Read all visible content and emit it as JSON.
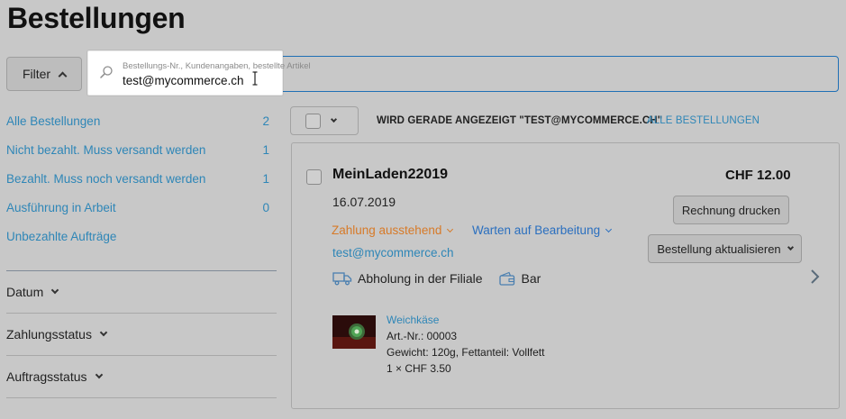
{
  "page": {
    "title": "Bestellungen"
  },
  "toolbar": {
    "filter_label": "Filter",
    "search_placeholder": "Bestellungs-Nr., Kundenangaben, bestellte Artikel",
    "search_value": "test@mycommerce.ch"
  },
  "sidebar": {
    "items": [
      {
        "label": "Alle Bestellungen",
        "count": "2"
      },
      {
        "label": "Nicht bezahlt. Muss versandt werden",
        "count": "1"
      },
      {
        "label": "Bezahlt. Muss noch versandt werden",
        "count": "1"
      },
      {
        "label": "Ausführung in Arbeit",
        "count": "0"
      },
      {
        "label": "Unbezahlte Aufträge",
        "count": ""
      }
    ],
    "sections": [
      {
        "label": "Datum"
      },
      {
        "label": "Zahlungsstatus"
      },
      {
        "label": "Auftragsstatus"
      }
    ]
  },
  "listing": {
    "showing_label": "WIRD GERADE ANGEZEIGT \"TEST@MYCOMMERCE.CH\"",
    "all_orders_link": "ALLE BESTELLUNGEN"
  },
  "order": {
    "name": "MeinLaden22019",
    "total": "CHF 12.00",
    "date": "16.07.2019",
    "print_button": "Rechnung drucken",
    "update_button": "Bestellung aktualisieren",
    "payment_status": "Zahlung ausstehend",
    "fulfillment_status": "Warten auf Bearbeitung",
    "email": "test@mycommerce.ch",
    "shipping": "Abholung in der Filiale",
    "payment_method": "Bar",
    "product": {
      "name": "Weichkäse",
      "sku": "Art.-Nr.: 00003",
      "details": "Gewicht: 120g, Fettanteil: Vollfett",
      "qty_price": "1 × CHF 3.50"
    }
  },
  "colors": {
    "link": "#2e86b7",
    "payment_pending": "#d77a28",
    "fulfillment": "#2a6fbf",
    "focus_border": "#1f6fb5"
  }
}
